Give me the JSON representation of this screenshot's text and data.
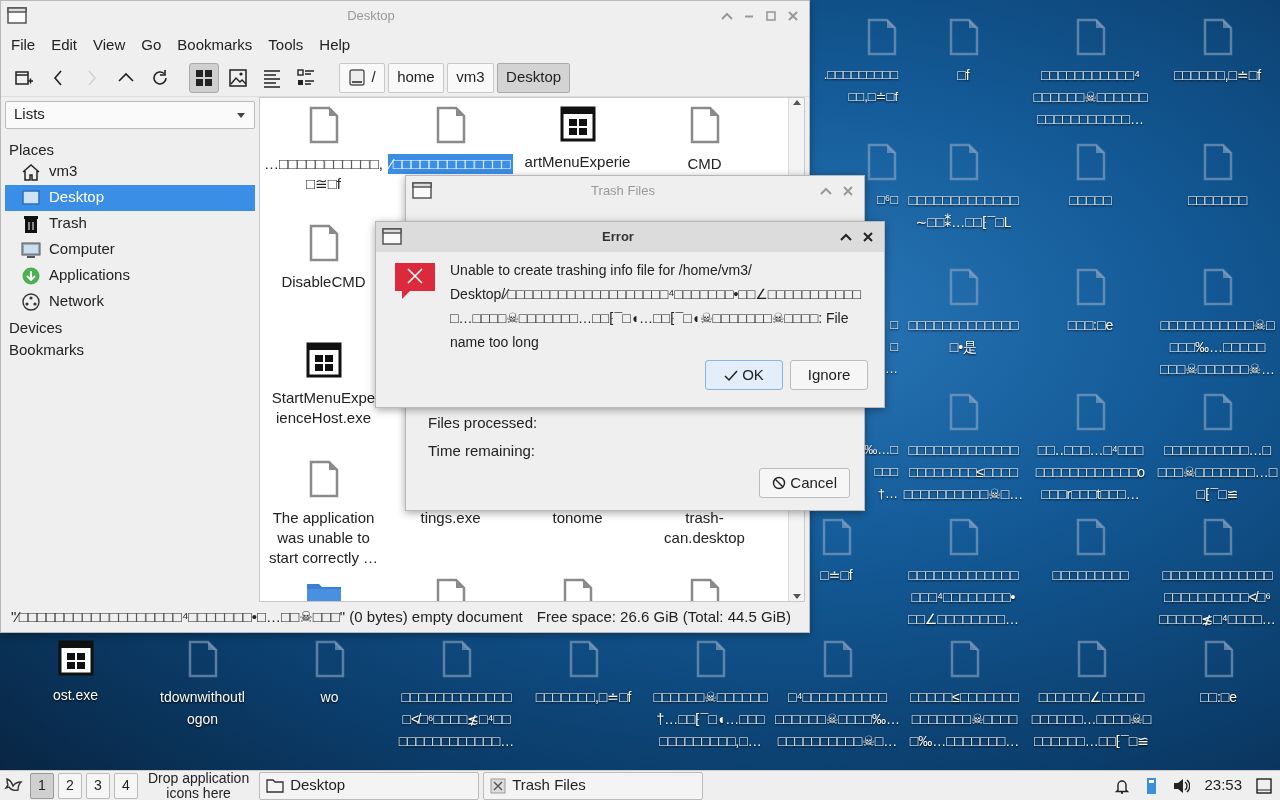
{
  "file_manager": {
    "title": "Desktop",
    "menu": [
      "File",
      "Edit",
      "View",
      "Go",
      "Bookmarks",
      "Tools",
      "Help"
    ],
    "toolbar": [
      {
        "kind": "new-tab",
        "selected": false,
        "disabled": false
      },
      {
        "kind": "back",
        "selected": false,
        "disabled": false
      },
      {
        "kind": "forward",
        "selected": false,
        "disabled": true
      },
      {
        "kind": "up",
        "selected": false,
        "disabled": false
      },
      {
        "kind": "reload",
        "selected": false,
        "disabled": false
      },
      {
        "kind": "icon-view",
        "selected": true,
        "disabled": false
      },
      {
        "kind": "thumbnail-view",
        "selected": false,
        "disabled": false
      },
      {
        "kind": "compact-view",
        "selected": false,
        "disabled": false
      },
      {
        "kind": "detail-view",
        "selected": false,
        "disabled": false
      }
    ],
    "path": [
      {
        "label": "/",
        "kind": "drive",
        "selected": false
      },
      {
        "label": "home",
        "kind": "folder",
        "selected": false
      },
      {
        "label": "vm3",
        "kind": "folder",
        "selected": false
      },
      {
        "label": "Desktop",
        "kind": "folder",
        "selected": true
      }
    ],
    "sidebar": {
      "dropdown": "Lists",
      "sections": [
        {
          "header": "Places",
          "items": [
            {
              "label": "vm3",
              "kind": "home",
              "selected": false
            },
            {
              "label": "Desktop",
              "kind": "desktop",
              "selected": true
            },
            {
              "label": "Trash",
              "kind": "trash",
              "selected": false
            },
            {
              "label": "Computer",
              "kind": "computer",
              "selected": false
            },
            {
              "label": "Applications",
              "kind": "applications",
              "selected": false
            },
            {
              "label": "Network",
              "kind": "network",
              "selected": false
            }
          ]
        },
        {
          "header": "Devices"
        },
        {
          "header": "Bookmarks"
        }
      ]
    },
    "rows": [
      [
        {
          "label": "…□□□□□□□□□□□,\n□≅□f",
          "kind": "file",
          "selected": false
        },
        {
          "label": "⁄□□□□□□□□□□□□□",
          "kind": "file",
          "selected": true
        },
        {
          "label": "artMenuExperie",
          "kind": "program",
          "selected": false
        },
        {
          "label": "CMD",
          "kind": "file",
          "selected": false
        }
      ],
      [
        {
          "label": "DisableCMD",
          "kind": "file",
          "selected": false
        }
      ],
      [
        {
          "label": "StartMenuExpe\nienceHost.exe",
          "kind": "program",
          "selected": false
        }
      ],
      [
        {
          "label": "The application\nwas unable to\nstart correctly …",
          "kind": "file",
          "selected": false
        },
        {
          "label": "tings.exe",
          "kind": "blank",
          "selected": false
        },
        {
          "label": "tonome",
          "kind": "blank",
          "selected": false
        },
        {
          "label": "trash-\ncan.desktop",
          "kind": "blank",
          "selected": false
        }
      ],
      [
        {
          "kind": "folder",
          "selected": false
        },
        {
          "kind": "file",
          "selected": false
        },
        {
          "kind": "file",
          "selected": false
        },
        {
          "kind": "file",
          "selected": false
        }
      ]
    ],
    "status": {
      "selection": "\"⁄□□□□□□□□□□□□□□□□□□⁴□□□□□□□•□…□□☠□□□\" (0 bytes) empty document",
      "free_space": "Free space: 26.6 GiB (Total: 44.5 GiB)"
    }
  },
  "trash_dialog": {
    "title": "Trash Files",
    "fields": [
      "Files processed:",
      "Time remaining:"
    ],
    "button": "Cancel"
  },
  "error_dialog": {
    "title": "Error",
    "message": "Unable to create trashing info file for /home/vm3/\nDesktop/⁄□□□□□□□□□□□□□□□□□□□⁴□□□□□□□•□□∠□□□□□□□□□□□\n□…□□□□☠□□□□□□□…□□⁅¯□◖…□□⁅¯□◖☠□□□□□□□☠□□□□: File\nname too long",
    "buttons": [
      {
        "label": "OK",
        "default": true
      },
      {
        "label": "Ignore",
        "default": false
      }
    ]
  },
  "desktop": {
    "grid": [
      {
        "label": ".□□□□□□□□□\n□□,□≐□f",
        "kind": "clipped"
      },
      {
        "label": "□f",
        "kind": "file"
      },
      {
        "label": "□□□□□□□□□□□⁴\n□□□□□□☠□□□□□□\n□□□□□□□□□□□…",
        "kind": "file"
      },
      {
        "label": "□□□□□□,□≐□f",
        "kind": "file"
      },
      {
        "label": "□⁶□",
        "kind": "clipped"
      },
      {
        "label": "□□□□□□□□□□□□□\n∼□□⁑…□□⁅¯□L",
        "kind": "file"
      },
      {
        "label": "□□□□□",
        "kind": "file"
      },
      {
        "label": "□□□□□□□",
        "kind": "file"
      },
      {
        "label": "□\n□\n…",
        "kind": "hidden"
      },
      {
        "label": "□□□□□□□□□□□□□\n□•是",
        "kind": "file"
      },
      {
        "label": "□□□:□e",
        "kind": "file"
      },
      {
        "label": "□□□□□□□□□□□☠□\n□□□‰…□□□□□\n□□□☠□□□□□□☠…",
        "kind": "file"
      },
      {
        "label": "‰…□\n□□□\n†…",
        "kind": "hidden"
      },
      {
        "label": "□□□□□□□□□□□□□\n□□□□□□□□≤□□□□\n□□□□□□□□□□☠□…",
        "kind": "file"
      },
      {
        "label": "□□‥□□□…□⁴□□□\n□□□□□□□□□□□□o\n□□□r□□□t□□□…",
        "kind": "file"
      },
      {
        "label": "□□□□□□□□□□…□\n□□□☠□□□□□□□…□\n□⁅¯□≌",
        "kind": "file"
      },
      {
        "label": "□≐□f",
        "kind": "file"
      },
      {
        "label": "□□□□□□□□□□□□□\n□□□⁴□□□□□□□□•\n□□∠□□□□□□□□…",
        "kind": "file"
      },
      {
        "label": "□□□□□□□□□",
        "kind": "file"
      },
      {
        "label": "□□□□□□□□□□□□□\n□□□□□□□□□□≮□⁶\n□□□□□≴□⁴□□□□…",
        "kind": "file"
      }
    ],
    "bottom_row": [
      {
        "label": "ost.exe",
        "kind": "program"
      },
      {
        "label": "tdownwithoutl\nogon",
        "kind": "file"
      },
      {
        "label": "wo",
        "kind": "file"
      },
      {
        "label": "□□□□□□□□□□□□□\n□≮□⁶□□□□≴□⁴□□\n□□□□□□□□□□□□…",
        "kind": "file"
      },
      {
        "label": "□□□□□□□,□≐□f",
        "kind": "file"
      },
      {
        "label": "□□□□□□☠□□□□□□\n†…□□⁅¯□◖…□□□\n□□□□□□□□□,□…",
        "kind": "file"
      },
      {
        "label": "□⁴□□□□□□□□□□\n□□□□□□☠□□□□‰…\n□□□□□□□□□□☠□…",
        "kind": "file"
      },
      {
        "label": "□□□□□≤□□□□□□□\n□□□□□□□☠□□□□\n□‰…□□□□□□□…",
        "kind": "file"
      },
      {
        "label": "□□□□□□∠□□□□□\n□□□□□□…□□□□☠□\n□□□□□□…□□⁅¯□≌",
        "kind": "file"
      },
      {
        "label": "□□:□e",
        "kind": "file"
      }
    ]
  },
  "taskbar": {
    "desktops": [
      {
        "label": "1",
        "selected": true
      },
      {
        "label": "2",
        "selected": false
      },
      {
        "label": "3",
        "selected": false
      },
      {
        "label": "4",
        "selected": false
      }
    ],
    "drop_hint": "Drop application\nicons here",
    "tasks": [
      {
        "label": "Desktop",
        "kind": "folder"
      },
      {
        "label": "Trash Files",
        "kind": "app"
      }
    ],
    "clock": "23:53"
  }
}
